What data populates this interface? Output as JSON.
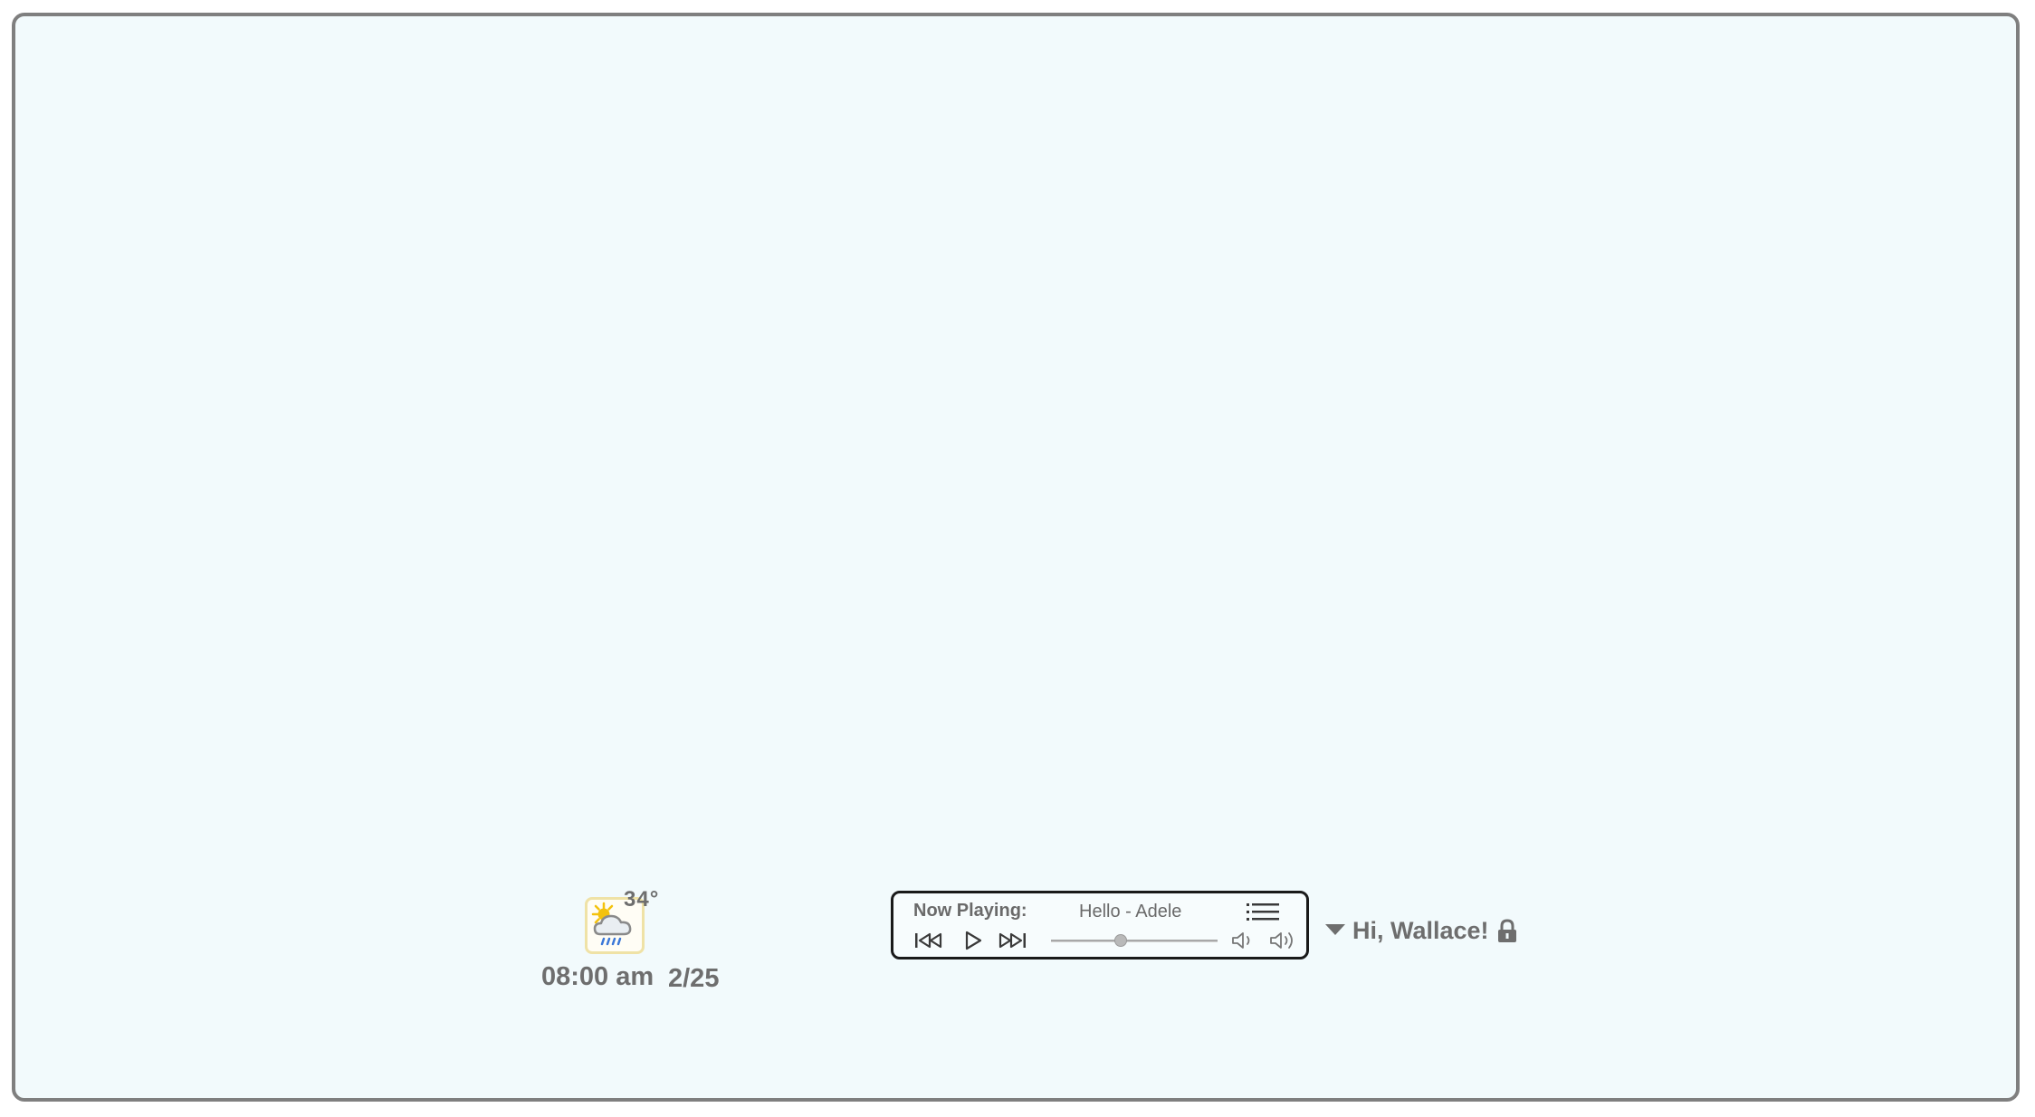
{
  "weather": {
    "temperature": "34°",
    "condition_icon": "partly-cloudy-rain-icon",
    "time": "08:00 am",
    "date": "2/25"
  },
  "music_player": {
    "now_playing_label": "Now Playing:",
    "track": "Hello - Adele",
    "progress_fraction": 0.41,
    "controls": {
      "previous_icon": "skip-back-icon",
      "play_icon": "play-icon",
      "next_icon": "skip-forward-icon",
      "playlist_icon": "playlist-icon",
      "volume_down_icon": "volume-down-icon",
      "volume_up_icon": "volume-up-icon"
    }
  },
  "user": {
    "greeting": "Hi, Wallace!",
    "menu_icon": "caret-down-icon",
    "lock_icon": "lock-icon"
  },
  "colors": {
    "desktop_bg": "#f2fafc",
    "frame": "#7f7f7f",
    "text": "#6e6e6e",
    "player_border": "#1a1a1a",
    "weather_border": "#efe2a6",
    "sun": "#f4c20d",
    "rain": "#3b78d8"
  }
}
